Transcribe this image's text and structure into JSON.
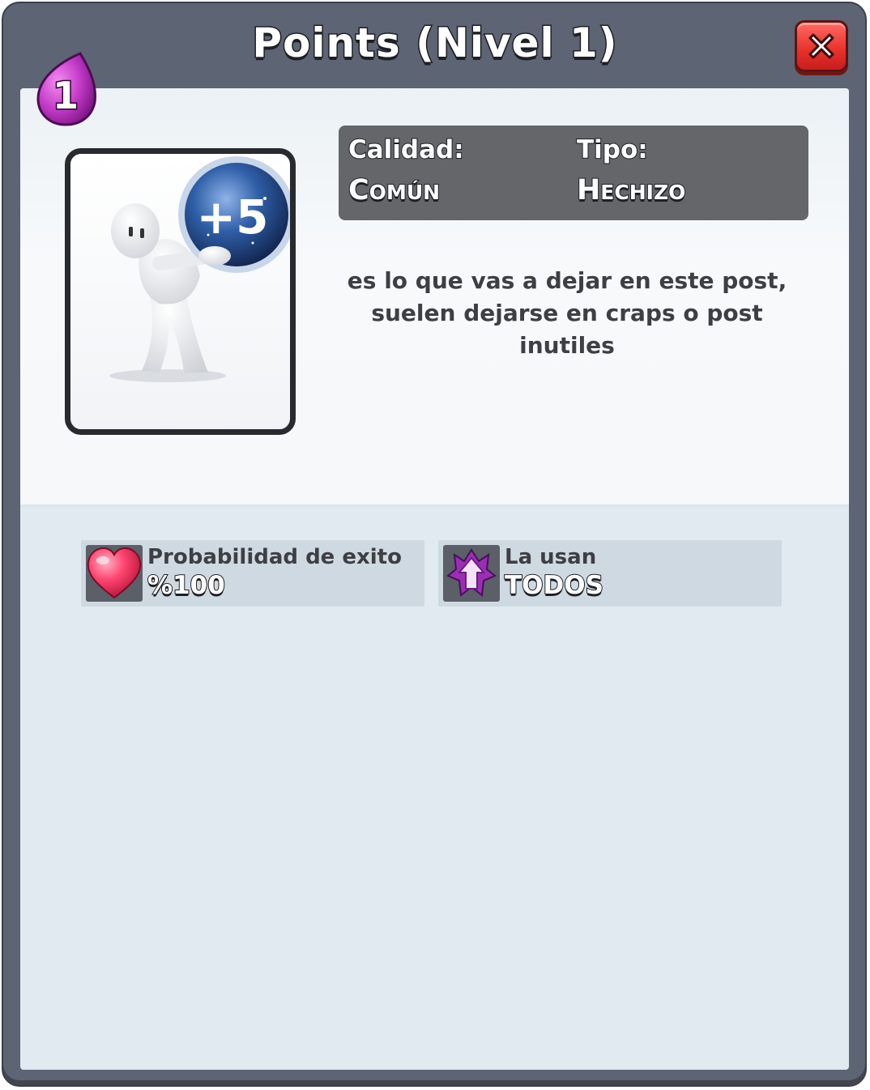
{
  "header": {
    "title": "Points (Nivel 1)"
  },
  "card": {
    "elixir_cost": "1",
    "image_badge": "+5",
    "quality_label": "Calidad:",
    "quality_value": "Común",
    "type_label": "Tipo:",
    "type_value": "Hechizo",
    "description": "es lo que vas a dejar en este post, suelen dejarse en craps o post inutiles"
  },
  "stats": [
    {
      "icon": "heart-icon",
      "label": "Probabilidad de exito",
      "value": "%100"
    },
    {
      "icon": "crown-arrow-icon",
      "label": "La usan",
      "value": "TODOS"
    }
  ],
  "colors": {
    "frame": "#5d6473",
    "panel": "#e1eaf0",
    "info_box": "#646669",
    "close_button": "#e8302b",
    "elixir": "#c43cc8",
    "stat_bg": "#cfd9e1"
  }
}
